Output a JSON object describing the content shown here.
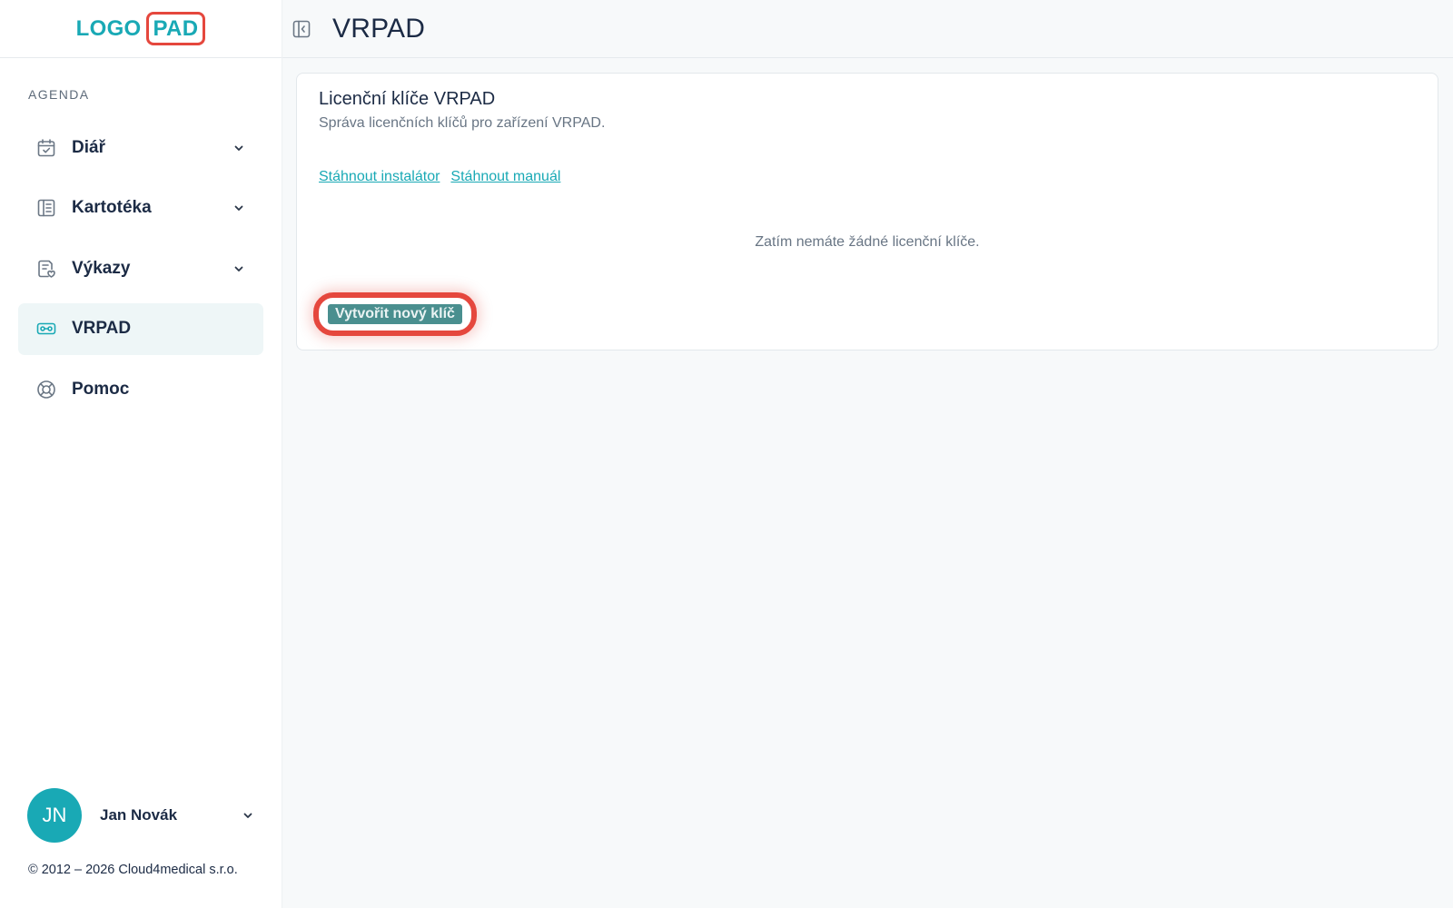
{
  "logo": {
    "part1": "LOGO",
    "part2": "PAD"
  },
  "sidebar": {
    "section_label": "AGENDA",
    "items": [
      {
        "label": "Diář",
        "icon": "calendar-check-icon",
        "expandable": true
      },
      {
        "label": "Kartotéka",
        "icon": "file-cabinet-icon",
        "expandable": true
      },
      {
        "label": "Výkazy",
        "icon": "report-icon",
        "expandable": true
      },
      {
        "label": "VRPAD",
        "icon": "vr-headset-icon",
        "expandable": false,
        "active": true
      },
      {
        "label": "Pomoc",
        "icon": "lifebuoy-icon",
        "expandable": false
      }
    ]
  },
  "user": {
    "initials": "JN",
    "name": "Jan Novák"
  },
  "footer": {
    "copyright": "© 2012 – 2026 Cloud4medical s.r.o."
  },
  "header": {
    "title": "VRPAD"
  },
  "card": {
    "title": "Licenční klíče VRPAD",
    "subtitle": "Správa licenčních klíčů pro zařízení VRPAD.",
    "link_installer": "Stáhnout instalátor",
    "link_manual": "Stáhnout manuál",
    "empty_message": "Zatím nemáte žádné licenční klíče.",
    "create_button": "Vytvořit nový klíč"
  },
  "colors": {
    "accent": "#19a9b5",
    "highlight": "#e5473d",
    "button": "#4a8f8f",
    "text": "#1c2b45"
  }
}
